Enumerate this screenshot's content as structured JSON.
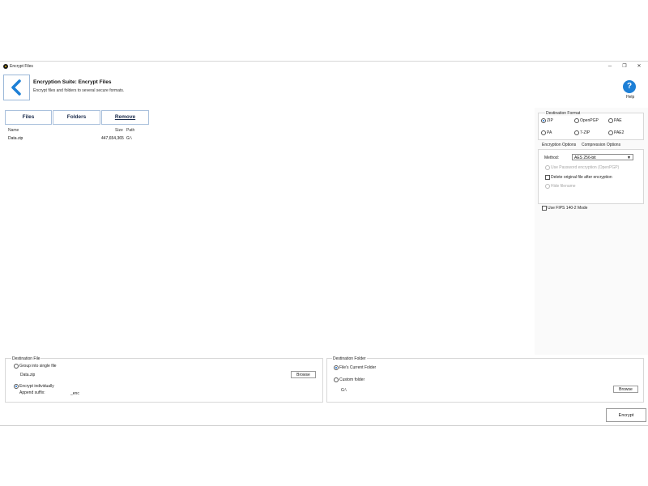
{
  "window": {
    "title": "Encrypt Files",
    "minimize_glyph": "─",
    "maximize_glyph": "❐",
    "close_glyph": "✕"
  },
  "header": {
    "title": "Encryption Suite: Encrypt Files",
    "subtitle": "Encrypt files and folders to several secure formats.",
    "help_glyph": "?",
    "help_label": "Help"
  },
  "toolbar": {
    "files_label": "Files",
    "folders_label": "Folders",
    "remove_label": "Remove"
  },
  "file_list": {
    "columns": [
      "Name",
      "Size",
      "Path"
    ],
    "rows": [
      {
        "name": "Data.zip",
        "size": "447,654,365",
        "path": "G:\\"
      }
    ]
  },
  "destination_format": {
    "label": "Destination Format",
    "options": [
      "ZIP",
      "OpenPGP",
      "PAE",
      "PA",
      "7-ZIP",
      "PAE2"
    ],
    "selected": "ZIP"
  },
  "options_tabs": [
    "Encryption Options",
    "Compression Options"
  ],
  "encryption_options": {
    "method_label": "Method:",
    "method_value": "AES 256-bit",
    "use_password_label": "Use Password encryption (OpenPGP)",
    "delete_original_label": "Delete original file after encryption",
    "hide_filename_label": "Hide filename"
  },
  "fips_label": "Use FIPS 140-2 Mode",
  "destination_file": {
    "label": "Destination File",
    "group_label": "Group into single file",
    "group_value": "Data.zip",
    "browse_label": "Browse",
    "individual_label": "Encrypt individually",
    "suffix_label": "Append suffix:",
    "suffix_value": "_enc"
  },
  "destination_folder": {
    "label": "Destination Folder",
    "current_label": "File's Current Folder",
    "custom_label": "Custom folder",
    "custom_value": "G:\\",
    "browse_label": "Browse"
  },
  "encrypt_label": "Encrypt",
  "colors": {
    "accent": "#1d7fd6",
    "back_arrow": "#1d7fd6"
  },
  "icons": {
    "back": "back-arrow-icon",
    "help": "help-icon",
    "app": "app-icon"
  }
}
